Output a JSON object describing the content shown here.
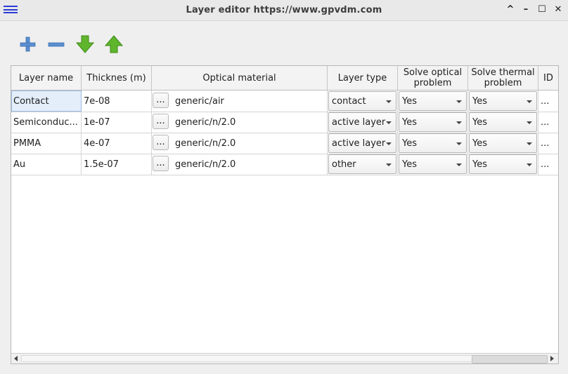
{
  "window": {
    "title": "Layer editor https://www.gpvdm.com",
    "controls": {
      "collapse": "^",
      "minimize": "–",
      "maximize": "☐",
      "close": "✕"
    }
  },
  "toolbar": {
    "buttons": [
      {
        "icon": "add-icon"
      },
      {
        "icon": "remove-icon"
      },
      {
        "icon": "move-down-icon"
      },
      {
        "icon": "move-up-icon"
      }
    ]
  },
  "table": {
    "headers": {
      "layer_name": "Layer name",
      "thickness": "Thicknes (m)",
      "optical_material": "Optical material",
      "layer_type": "Layer type",
      "solve_optical_l1": "Solve optical",
      "solve_optical_l2": "problem",
      "solve_thermal_l1": "Solve thermal",
      "solve_thermal_l2": "problem",
      "id": "ID"
    },
    "browse_label": "...",
    "rows": [
      {
        "name": "Contact",
        "thickness": "7e-08",
        "material": "generic/air",
        "type": "contact",
        "optical": "Yes",
        "thermal": "Yes",
        "id": "..."
      },
      {
        "name": "Semiconduc...",
        "thickness": "1e-07",
        "material": "generic/n/2.0",
        "type": "active layer",
        "optical": "Yes",
        "thermal": "Yes",
        "id": "..."
      },
      {
        "name": "PMMA",
        "thickness": "4e-07",
        "material": "generic/n/2.0",
        "type": "active layer",
        "optical": "Yes",
        "thermal": "Yes",
        "id": "..."
      },
      {
        "name": "Au",
        "thickness": "1.5e-07",
        "material": "generic/n/2.0",
        "type": "other",
        "optical": "Yes",
        "thermal": "Yes",
        "id": "..."
      }
    ]
  }
}
